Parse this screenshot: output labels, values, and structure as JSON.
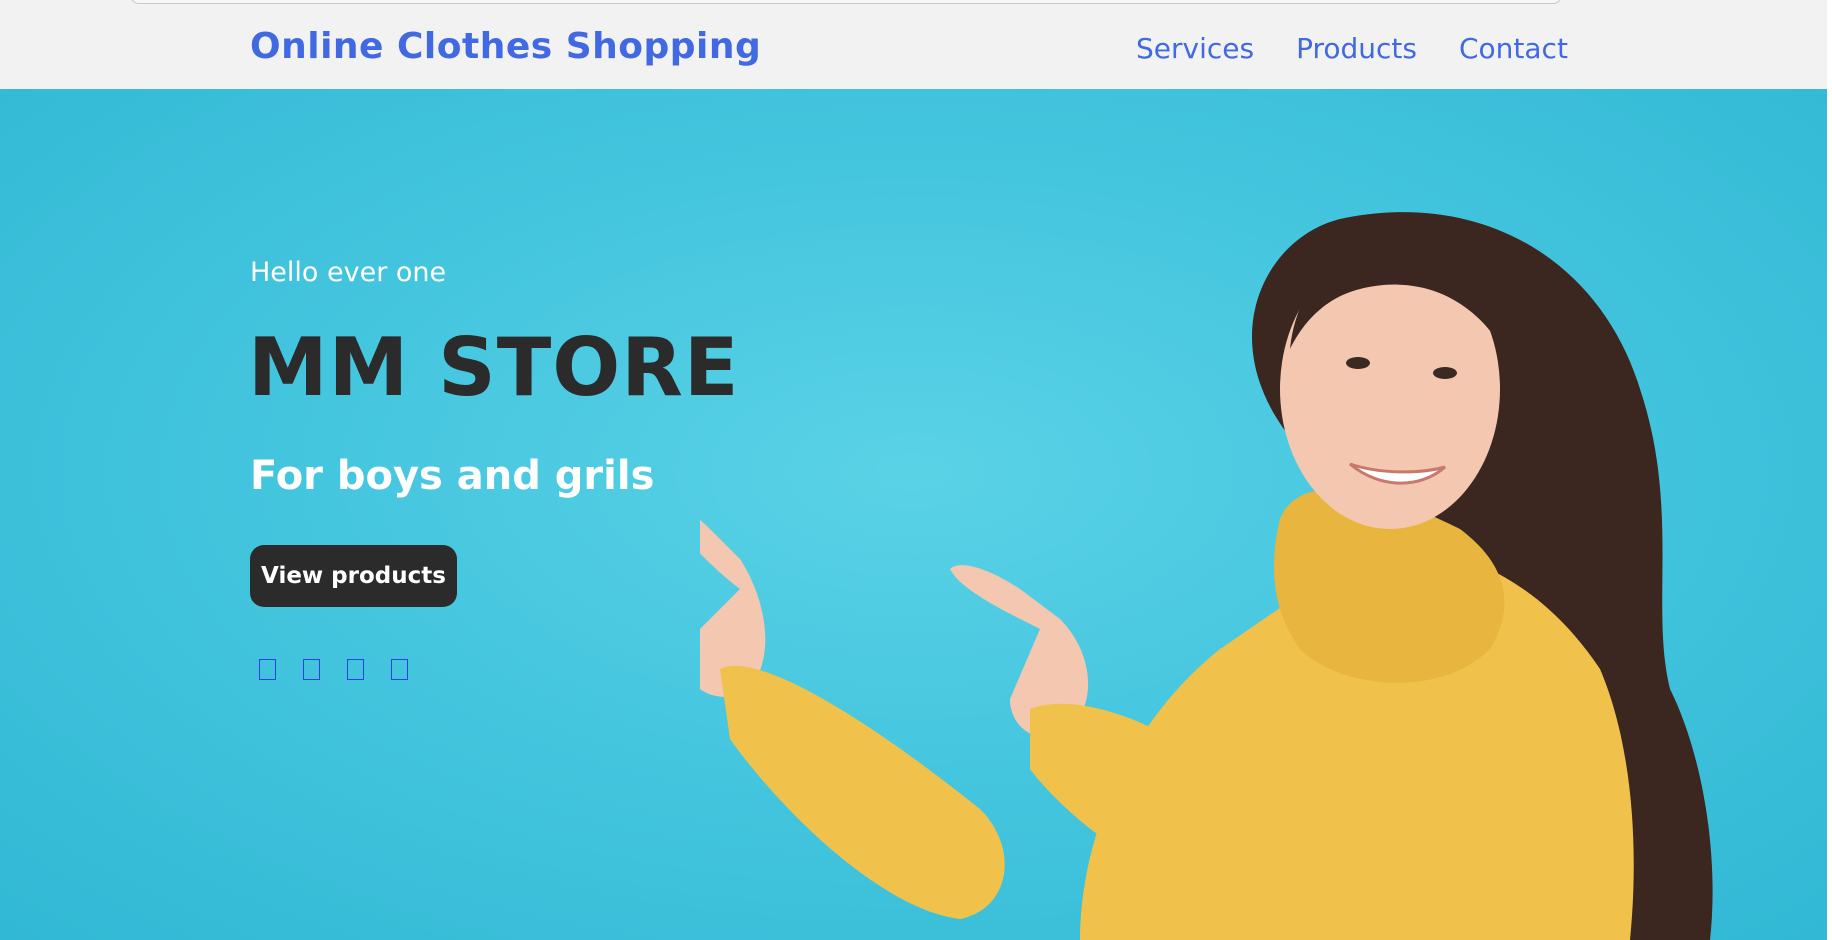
{
  "header": {
    "brand": "Online Clothes Shopping",
    "nav": [
      {
        "label": "Services"
      },
      {
        "label": "Products"
      },
      {
        "label": "Contact"
      }
    ]
  },
  "hero": {
    "greeting": "Hello ever one",
    "title": "MM STORE",
    "tagline": "For boys and grils",
    "cta_label": "View products",
    "social_icons": [
      "facebook-icon",
      "twitter-icon",
      "instagram-icon",
      "linkedin-icon"
    ]
  },
  "colors": {
    "brand": "#4169e1",
    "hero_bg": "#45c6df",
    "title": "#2b2b2b",
    "cta_bg": "#2c2b2b",
    "sweater": "#f0c24c"
  }
}
